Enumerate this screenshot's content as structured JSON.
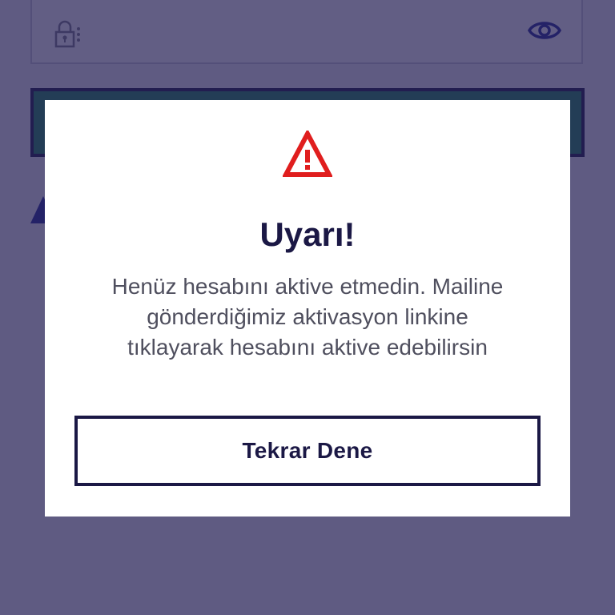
{
  "background": {
    "password_field": {
      "lock_icon": "lock-icon",
      "visibility_icon": "eye-icon"
    },
    "login_button_color": "#1f8a5a"
  },
  "scrim_color": "#262054",
  "dialog": {
    "icon": "warning-triangle-icon",
    "icon_color": "#e01e1e",
    "title": "Uyarı!",
    "message": "Henüz hesabını aktive etmedin. Mailine gönderdiğimiz aktivasyon linkine tıklayarak hesabını aktive edebilirsin",
    "retry_label": "Tekrar Dene"
  },
  "colors": {
    "brand_navy": "#1b1845",
    "text_gray": "#4f4f5e",
    "accent_blue": "#232a98"
  }
}
